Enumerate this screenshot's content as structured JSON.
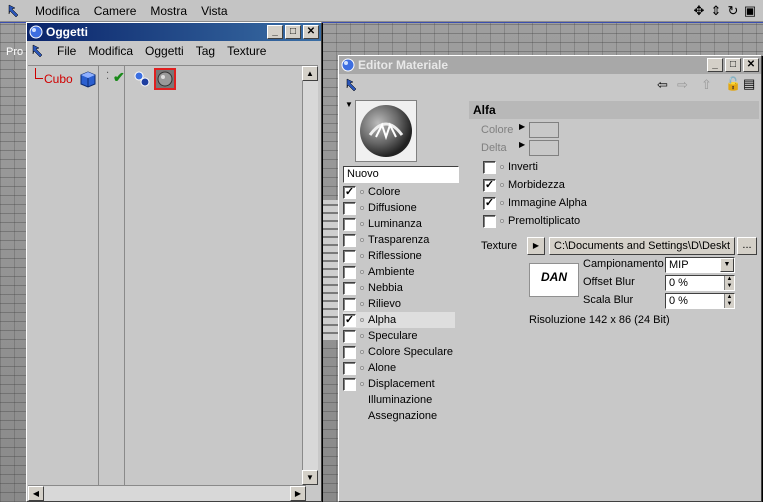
{
  "app": {
    "menu": [
      "Modifica",
      "Camere",
      "Mostra",
      "Vista"
    ],
    "viewport_tag": "Pro"
  },
  "oggetti": {
    "title": "Oggetti",
    "menu": [
      "File",
      "Modifica",
      "Oggetti",
      "Tag",
      "Texture"
    ],
    "object_name": "Cubo"
  },
  "editor": {
    "title": "Editor Materiale",
    "material_name": "Nuovo",
    "channels": [
      {
        "label": "Colore",
        "checked": true,
        "has_box": true
      },
      {
        "label": "Diffusione",
        "checked": false,
        "has_box": true
      },
      {
        "label": "Luminanza",
        "checked": false,
        "has_box": true
      },
      {
        "label": "Trasparenza",
        "checked": false,
        "has_box": true
      },
      {
        "label": "Riflessione",
        "checked": false,
        "has_box": true
      },
      {
        "label": "Ambiente",
        "checked": false,
        "has_box": true
      },
      {
        "label": "Nebbia",
        "checked": false,
        "has_box": true
      },
      {
        "label": "Rilievo",
        "checked": false,
        "has_box": true
      },
      {
        "label": "Alpha",
        "checked": true,
        "has_box": true,
        "selected": true
      },
      {
        "label": "Speculare",
        "checked": false,
        "has_box": true
      },
      {
        "label": "Colore Speculare",
        "checked": false,
        "has_box": true
      },
      {
        "label": "Alone",
        "checked": false,
        "has_box": true
      },
      {
        "label": "Displacement",
        "checked": false,
        "has_box": true
      },
      {
        "label": "Illuminazione",
        "checked": false,
        "has_box": false
      },
      {
        "label": "Assegnazione",
        "checked": false,
        "has_box": false
      }
    ],
    "panel": {
      "heading": "Alfa",
      "colore_label": "Colore",
      "delta_label": "Delta",
      "options": [
        {
          "label": "Inverti",
          "checked": false
        },
        {
          "label": "Morbidezza",
          "checked": true
        },
        {
          "label": "Immagine Alpha",
          "checked": true
        },
        {
          "label": "Premoltiplicato",
          "checked": false
        }
      ],
      "texture_label": "Texture",
      "texture_path": "C:\\Documents and Settings\\D\\Deskt",
      "browse_label": "...",
      "thumb_text": "DAN",
      "campionamento_label": "Campionamento",
      "campionamento_value": "MIP",
      "offset_blur_label": "Offset Blur",
      "offset_blur_value": "0 %",
      "scala_blur_label": "Scala Blur",
      "scala_blur_value": "0 %",
      "resolution": "Risoluzione 142 x 86  (24 Bit)"
    }
  }
}
